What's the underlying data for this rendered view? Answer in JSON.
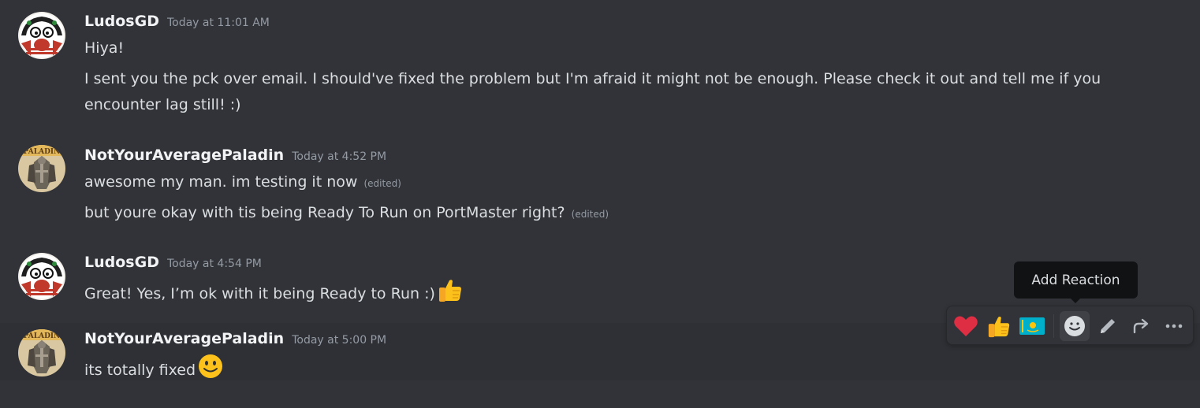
{
  "messages": [
    {
      "author": "LudosGD",
      "timestamp": "Today at 11:01 AM",
      "avatar": "ludos-avatar",
      "lines": [
        "Hiya!",
        "I sent you the pck over email. I should've fixed the problem but I'm afraid it might not be enough. Please check it out and tell me if you",
        "encounter lag still! :)"
      ]
    },
    {
      "author": "NotYourAveragePaladin",
      "timestamp": "Today at 4:52 PM",
      "avatar": "paladin-avatar",
      "lines": [
        "awesome my man. im testing it now",
        "but youre okay with tis being Ready To Run on PortMaster right?"
      ],
      "edited_label": "(edited)"
    },
    {
      "author": "LudosGD",
      "timestamp": "Today at 4:54 PM",
      "avatar": "ludos-avatar",
      "lines": [
        "Great! Yes, I’m ok with it being Ready to Run :)"
      ],
      "trailing_emoji": "thumbs-up"
    },
    {
      "author": "NotYourAveragePaladin",
      "timestamp": "Today at 5:00 PM",
      "avatar": "paladin-avatar",
      "lines": [
        "its totally fixed"
      ],
      "trailing_emoji": "slightly-smiling-face"
    }
  ],
  "tooltip": {
    "text": "Add Reaction"
  },
  "toolbar": {
    "buttons": [
      "heart-reaction",
      "thumbs-up-reaction",
      "kazakhstan-flag-reaction",
      "add-reaction",
      "edit",
      "forward",
      "more"
    ]
  },
  "colors": {
    "background": "#313338",
    "hover_background": "#2e3035",
    "author": "#f2f3f5",
    "text": "#dbdee1",
    "muted": "#949ba4",
    "tooltip_bg": "#111214"
  }
}
